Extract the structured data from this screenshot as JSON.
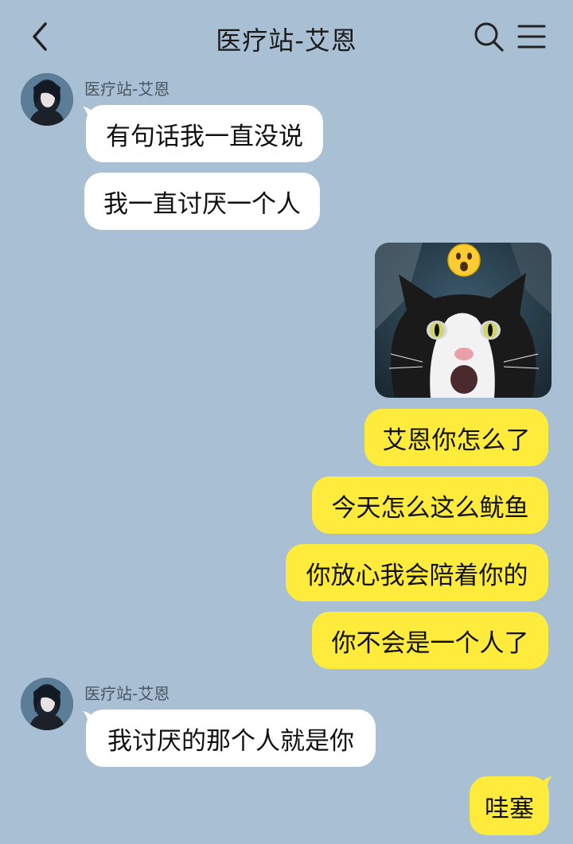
{
  "header": {
    "title": "医疗站-艾恩",
    "back_icon": "chevron-left-icon",
    "search_icon": "search-icon",
    "menu_icon": "menu-icon"
  },
  "messages": [
    {
      "side": "left",
      "sender": "医疗站-艾恩",
      "text": "有句话我一直没说"
    },
    {
      "side": "left",
      "text": "我一直讨厌一个人"
    },
    {
      "side": "right",
      "type": "sticker",
      "sticker": "surprised-cat-sticker",
      "reaction": "surprised-face-emoji"
    },
    {
      "side": "right",
      "text": "艾恩你怎么了"
    },
    {
      "side": "right",
      "text": "今天怎么这么鱿鱼"
    },
    {
      "side": "right",
      "text": "你放心我会陪着你的"
    },
    {
      "side": "right",
      "text": "你不会是一个人了"
    },
    {
      "side": "left",
      "sender": "医疗站-艾恩",
      "text": "我讨厌的那个人就是你"
    },
    {
      "side": "right",
      "text": "哇塞"
    }
  ],
  "colors": {
    "background": "#a9bfd3",
    "left_bubble": "#ffffff",
    "right_bubble": "#ffeb3b"
  }
}
